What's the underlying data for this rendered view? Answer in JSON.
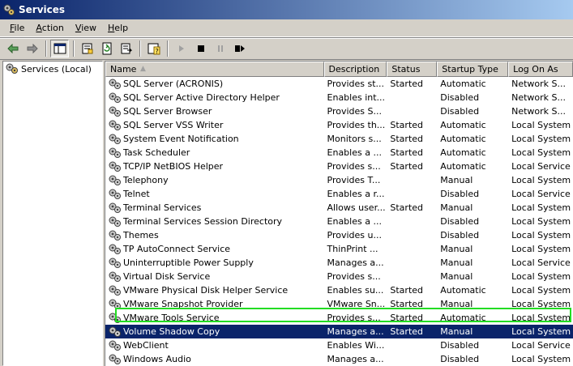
{
  "window": {
    "title": "Services"
  },
  "menu": [
    {
      "key": "F",
      "rest": "ile"
    },
    {
      "key": "A",
      "rest": "ction"
    },
    {
      "key": "V",
      "rest": "iew"
    },
    {
      "key": "H",
      "rest": "elp"
    }
  ],
  "toolbar": {
    "icons": [
      "back-arrow-icon",
      "forward-arrow-icon",
      "show-hide-tree-icon",
      "properties-icon",
      "refresh-icon",
      "export-list-icon",
      "help-icon",
      "start-service-icon",
      "stop-service-icon",
      "pause-service-icon",
      "restart-service-icon"
    ]
  },
  "tree": {
    "root_label": "Services (Local)"
  },
  "columns": {
    "name": "Name",
    "description": "Description",
    "status": "Status",
    "startup": "Startup Type",
    "logon": "Log On As"
  },
  "rows": [
    {
      "name": "SQL Server (ACRONIS)",
      "description": "Provides st...",
      "status": "Started",
      "startup": "Automatic",
      "logon": "Network S..."
    },
    {
      "name": "SQL Server Active Directory Helper",
      "description": "Enables int...",
      "status": "",
      "startup": "Disabled",
      "logon": "Network S..."
    },
    {
      "name": "SQL Server Browser",
      "description": "Provides S...",
      "status": "",
      "startup": "Disabled",
      "logon": "Network S..."
    },
    {
      "name": "SQL Server VSS Writer",
      "description": "Provides th...",
      "status": "Started",
      "startup": "Automatic",
      "logon": "Local System"
    },
    {
      "name": "System Event Notification",
      "description": "Monitors s...",
      "status": "Started",
      "startup": "Automatic",
      "logon": "Local System"
    },
    {
      "name": "Task Scheduler",
      "description": "Enables a ...",
      "status": "Started",
      "startup": "Automatic",
      "logon": "Local System"
    },
    {
      "name": "TCP/IP NetBIOS Helper",
      "description": "Provides s...",
      "status": "Started",
      "startup": "Automatic",
      "logon": "Local Service"
    },
    {
      "name": "Telephony",
      "description": "Provides T...",
      "status": "",
      "startup": "Manual",
      "logon": "Local System"
    },
    {
      "name": "Telnet",
      "description": "Enables a r...",
      "status": "",
      "startup": "Disabled",
      "logon": "Local Service"
    },
    {
      "name": "Terminal Services",
      "description": "Allows user...",
      "status": "Started",
      "startup": "Manual",
      "logon": "Local System"
    },
    {
      "name": "Terminal Services Session Directory",
      "description": "Enables a ...",
      "status": "",
      "startup": "Disabled",
      "logon": "Local System"
    },
    {
      "name": "Themes",
      "description": "Provides u...",
      "status": "",
      "startup": "Disabled",
      "logon": "Local System"
    },
    {
      "name": "TP AutoConnect Service",
      "description": "ThinPrint ...",
      "status": "",
      "startup": "Manual",
      "logon": "Local System"
    },
    {
      "name": "Uninterruptible Power Supply",
      "description": "Manages a...",
      "status": "",
      "startup": "Manual",
      "logon": "Local Service"
    },
    {
      "name": "Virtual Disk Service",
      "description": "Provides s...",
      "status": "",
      "startup": "Manual",
      "logon": "Local System"
    },
    {
      "name": "VMware Physical Disk Helper Service",
      "description": "Enables su...",
      "status": "Started",
      "startup": "Automatic",
      "logon": "Local System"
    },
    {
      "name": "VMware Snapshot Provider",
      "description": "VMware Sn...",
      "status": "Started",
      "startup": "Manual",
      "logon": "Local System"
    },
    {
      "name": "VMware Tools Service",
      "description": "Provides s...",
      "status": "Started",
      "startup": "Automatic",
      "logon": "Local System"
    },
    {
      "name": "Volume Shadow Copy",
      "description": "Manages a...",
      "status": "Started",
      "startup": "Manual",
      "logon": "Local System",
      "selected": true
    },
    {
      "name": "WebClient",
      "description": "Enables Wi...",
      "status": "",
      "startup": "Disabled",
      "logon": "Local Service"
    },
    {
      "name": "Windows Audio",
      "description": "Manages a...",
      "status": "",
      "startup": "Disabled",
      "logon": "Local System"
    }
  ],
  "colors": {
    "selection": "#0a246a",
    "highlight_outline": "#22dd22",
    "title_gradient_start": "#0a246a",
    "title_gradient_end": "#a6caf0"
  }
}
